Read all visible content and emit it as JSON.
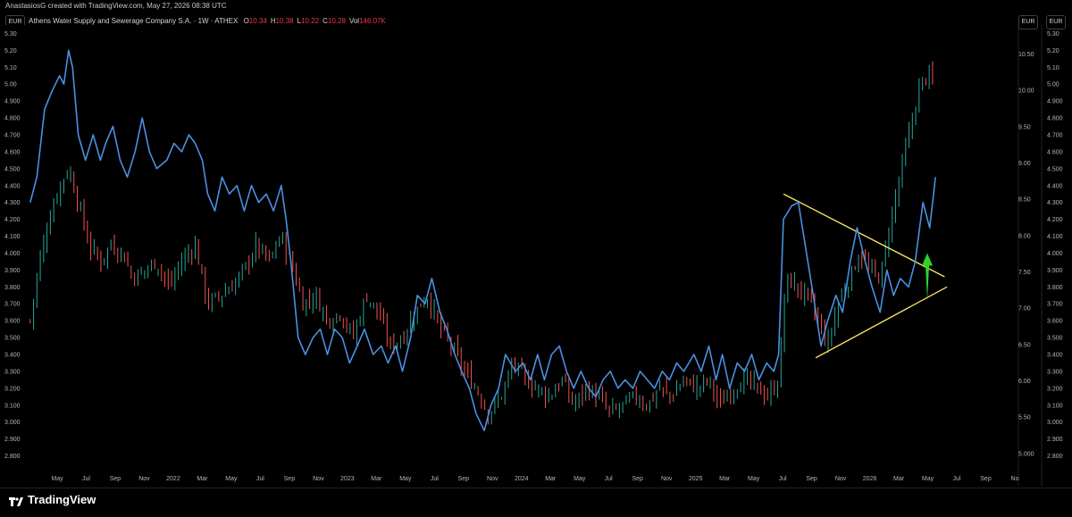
{
  "header": {
    "credit": "AnastasiosG created with TradingView.com, May 27, 2026 08:38 UTC",
    "symbol": "Athens Water Supply and Sewerage Company S.A. · 1W · ATHEX",
    "ohlc": [
      {
        "label": "O",
        "value": "10.34"
      },
      {
        "label": "H",
        "value": "10.38"
      },
      {
        "label": "L",
        "value": "10.22"
      },
      {
        "label": "C",
        "value": "10.28"
      },
      {
        "label": "Vol",
        "value": "146.07K"
      }
    ]
  },
  "currency_left": "EUR",
  "currency_right": "EUR",
  "brand": "TradingView",
  "colors": {
    "up": "#26a69a",
    "down": "#ef5350",
    "overlay_line": "#4a90e2",
    "trendline": "#f5e15a",
    "arrow": "#2bd42b"
  },
  "chart_data": {
    "type": "line",
    "x_ticks": [
      "May",
      "Jul",
      "Sep",
      "Nov",
      "2022",
      "Mar",
      "May",
      "Jul",
      "Sep",
      "Nov",
      "2023",
      "Mar",
      "May",
      "Jul",
      "Sep",
      "Nov",
      "2024",
      "Mar",
      "May",
      "Jul",
      "Sep",
      "Nov",
      "2025",
      "Mar",
      "May",
      "Jul",
      "Sep",
      "Nov",
      "2026",
      "Mar",
      "May",
      "Jul",
      "Sep",
      "No"
    ],
    "y_left_ticks": [
      "5.30",
      "5.20",
      "5.10",
      "5.00",
      "4.900",
      "4.800",
      "4.700",
      "4.600",
      "4.500",
      "4.400",
      "4.300",
      "4.200",
      "4.100",
      "4.000",
      "3.900",
      "3.800",
      "3.700",
      "3.600",
      "3.500",
      "3.400",
      "3.300",
      "3.200",
      "3.100",
      "3.000",
      "2.900",
      "2.800"
    ],
    "y_right_ticks": [
      "5.30",
      "5.20",
      "5.10",
      "5.00",
      "4.900",
      "4.800",
      "4.700",
      "4.600",
      "4.500",
      "4.400",
      "4.300",
      "4.200",
      "4.100",
      "4.000",
      "3.900",
      "3.800",
      "3.700",
      "3.600",
      "3.500",
      "3.400",
      "3.300",
      "3.200",
      "3.100",
      "3.000",
      "2.900",
      "2.800"
    ],
    "y_mid_ticks": [
      "10.50",
      "10.00",
      "9.50",
      "9.00",
      "8.50",
      "8.00",
      "7.50",
      "7.00",
      "6.50",
      "6.00",
      "5.50",
      "5.000"
    ],
    "ylim_left": [
      2.75,
      5.35
    ],
    "ylim_mid": [
      4.85,
      10.9
    ],
    "overlay_series": [
      [
        "2021-04-01",
        4.3
      ],
      [
        "2021-04-15",
        4.45
      ],
      [
        "2021-05-01",
        4.85
      ],
      [
        "2021-05-15",
        4.95
      ],
      [
        "2021-06-01",
        5.05
      ],
      [
        "2021-06-10",
        5.0
      ],
      [
        "2021-06-20",
        5.2
      ],
      [
        "2021-06-28",
        5.1
      ],
      [
        "2021-07-10",
        4.7
      ],
      [
        "2021-07-25",
        4.55
      ],
      [
        "2021-08-10",
        4.7
      ],
      [
        "2021-08-25",
        4.55
      ],
      [
        "2021-09-05",
        4.65
      ],
      [
        "2021-09-20",
        4.75
      ],
      [
        "2021-10-05",
        4.55
      ],
      [
        "2021-10-20",
        4.45
      ],
      [
        "2021-11-05",
        4.6
      ],
      [
        "2021-11-20",
        4.8
      ],
      [
        "2021-12-05",
        4.6
      ],
      [
        "2021-12-20",
        4.5
      ],
      [
        "2022-01-10",
        4.55
      ],
      [
        "2022-01-25",
        4.65
      ],
      [
        "2022-02-10",
        4.6
      ],
      [
        "2022-02-25",
        4.7
      ],
      [
        "2022-03-10",
        4.65
      ],
      [
        "2022-03-25",
        4.55
      ],
      [
        "2022-04-05",
        4.35
      ],
      [
        "2022-04-20",
        4.25
      ],
      [
        "2022-05-05",
        4.45
      ],
      [
        "2022-05-20",
        4.35
      ],
      [
        "2022-06-05",
        4.4
      ],
      [
        "2022-06-20",
        4.25
      ],
      [
        "2022-07-05",
        4.4
      ],
      [
        "2022-07-20",
        4.3
      ],
      [
        "2022-08-05",
        4.35
      ],
      [
        "2022-08-20",
        4.25
      ],
      [
        "2022-09-05",
        4.4
      ],
      [
        "2022-09-15",
        4.2
      ],
      [
        "2022-09-25",
        3.95
      ],
      [
        "2022-10-10",
        3.5
      ],
      [
        "2022-10-25",
        3.4
      ],
      [
        "2022-11-10",
        3.5
      ],
      [
        "2022-11-25",
        3.55
      ],
      [
        "2022-12-10",
        3.4
      ],
      [
        "2022-12-25",
        3.55
      ],
      [
        "2023-01-10",
        3.5
      ],
      [
        "2023-01-25",
        3.35
      ],
      [
        "2023-02-10",
        3.45
      ],
      [
        "2023-02-25",
        3.55
      ],
      [
        "2023-03-15",
        3.4
      ],
      [
        "2023-04-01",
        3.45
      ],
      [
        "2023-04-15",
        3.35
      ],
      [
        "2023-05-01",
        3.45
      ],
      [
        "2023-05-15",
        3.3
      ],
      [
        "2023-06-01",
        3.5
      ],
      [
        "2023-06-15",
        3.75
      ],
      [
        "2023-07-01",
        3.7
      ],
      [
        "2023-07-15",
        3.85
      ],
      [
        "2023-08-01",
        3.65
      ],
      [
        "2023-08-15",
        3.55
      ],
      [
        "2023-09-01",
        3.4
      ],
      [
        "2023-09-15",
        3.3
      ],
      [
        "2023-10-01",
        3.2
      ],
      [
        "2023-10-15",
        3.05
      ],
      [
        "2023-11-01",
        2.95
      ],
      [
        "2023-11-15",
        3.1
      ],
      [
        "2023-12-01",
        3.2
      ],
      [
        "2023-12-15",
        3.4
      ],
      [
        "2024-01-05",
        3.3
      ],
      [
        "2024-01-20",
        3.35
      ],
      [
        "2024-02-05",
        3.25
      ],
      [
        "2024-02-20",
        3.4
      ],
      [
        "2024-03-05",
        3.25
      ],
      [
        "2024-03-20",
        3.4
      ],
      [
        "2024-04-05",
        3.45
      ],
      [
        "2024-04-20",
        3.3
      ],
      [
        "2024-05-05",
        3.2
      ],
      [
        "2024-05-20",
        3.3
      ],
      [
        "2024-06-05",
        3.2
      ],
      [
        "2024-06-20",
        3.15
      ],
      [
        "2024-07-05",
        3.25
      ],
      [
        "2024-07-20",
        3.3
      ],
      [
        "2024-08-05",
        3.2
      ],
      [
        "2024-08-20",
        3.25
      ],
      [
        "2024-09-05",
        3.2
      ],
      [
        "2024-09-20",
        3.3
      ],
      [
        "2024-10-05",
        3.25
      ],
      [
        "2024-10-20",
        3.2
      ],
      [
        "2024-11-05",
        3.3
      ],
      [
        "2024-11-20",
        3.25
      ],
      [
        "2024-12-05",
        3.35
      ],
      [
        "2024-12-20",
        3.3
      ],
      [
        "2025-01-10",
        3.4
      ],
      [
        "2025-01-25",
        3.3
      ],
      [
        "2025-02-10",
        3.45
      ],
      [
        "2025-02-25",
        3.25
      ],
      [
        "2025-03-10",
        3.4
      ],
      [
        "2025-03-25",
        3.2
      ],
      [
        "2025-04-10",
        3.35
      ],
      [
        "2025-04-25",
        3.3
      ],
      [
        "2025-05-10",
        3.4
      ],
      [
        "2025-05-25",
        3.25
      ],
      [
        "2025-06-10",
        3.35
      ],
      [
        "2025-06-25",
        3.3
      ],
      [
        "2025-07-05",
        3.4
      ],
      [
        "2025-07-15",
        4.2
      ],
      [
        "2025-08-01",
        4.28
      ],
      [
        "2025-08-15",
        4.3
      ],
      [
        "2025-09-01",
        4.0
      ],
      [
        "2025-09-15",
        3.75
      ],
      [
        "2025-10-01",
        3.45
      ],
      [
        "2025-10-15",
        3.6
      ],
      [
        "2025-11-01",
        3.75
      ],
      [
        "2025-11-15",
        3.65
      ],
      [
        "2025-12-01",
        3.95
      ],
      [
        "2025-12-15",
        4.15
      ],
      [
        "2026-01-01",
        3.95
      ],
      [
        "2026-01-15",
        3.8
      ],
      [
        "2026-02-01",
        3.65
      ],
      [
        "2026-02-15",
        3.9
      ],
      [
        "2026-03-01",
        3.75
      ],
      [
        "2026-03-15",
        3.85
      ],
      [
        "2026-04-01",
        3.8
      ],
      [
        "2026-04-15",
        3.95
      ],
      [
        "2026-05-01",
        4.3
      ],
      [
        "2026-05-15",
        4.15
      ],
      [
        "2026-05-27",
        4.45
      ]
    ],
    "price_series": [
      [
        "2021-04-01",
        3.6
      ],
      [
        "2021-04-20",
        3.95
      ],
      [
        "2021-05-10",
        4.2
      ],
      [
        "2021-06-01",
        4.4
      ],
      [
        "2021-06-20",
        4.5
      ],
      [
        "2021-07-10",
        4.3
      ],
      [
        "2021-08-01",
        4.05
      ],
      [
        "2021-08-25",
        3.95
      ],
      [
        "2021-09-15",
        4.05
      ],
      [
        "2021-10-10",
        4.0
      ],
      [
        "2021-11-01",
        3.85
      ],
      [
        "2021-11-25",
        3.9
      ],
      [
        "2021-12-20",
        3.95
      ],
      [
        "2022-01-15",
        3.8
      ],
      [
        "2022-02-10",
        3.95
      ],
      [
        "2022-03-10",
        4.05
      ],
      [
        "2022-04-05",
        3.7
      ],
      [
        "2022-05-01",
        3.75
      ],
      [
        "2022-05-25",
        3.8
      ],
      [
        "2022-06-20",
        3.9
      ],
      [
        "2022-07-15",
        4.05
      ],
      [
        "2022-08-10",
        3.95
      ],
      [
        "2022-09-05",
        4.1
      ],
      [
        "2022-09-25",
        3.95
      ],
      [
        "2022-10-20",
        3.7
      ],
      [
        "2022-11-15",
        3.75
      ],
      [
        "2022-12-10",
        3.6
      ],
      [
        "2023-01-05",
        3.65
      ],
      [
        "2023-02-01",
        3.5
      ],
      [
        "2023-03-01",
        3.75
      ],
      [
        "2023-03-25",
        3.65
      ],
      [
        "2023-04-20",
        3.45
      ],
      [
        "2023-05-15",
        3.5
      ],
      [
        "2023-06-10",
        3.65
      ],
      [
        "2023-07-05",
        3.75
      ],
      [
        "2023-08-01",
        3.55
      ],
      [
        "2023-08-25",
        3.45
      ],
      [
        "2023-09-20",
        3.3
      ],
      [
        "2023-10-15",
        3.2
      ],
      [
        "2023-11-10",
        3.05
      ],
      [
        "2023-12-05",
        3.15
      ],
      [
        "2024-01-01",
        3.35
      ],
      [
        "2024-01-25",
        3.25
      ],
      [
        "2024-02-20",
        3.2
      ],
      [
        "2024-03-15",
        3.15
      ],
      [
        "2024-04-10",
        3.25
      ],
      [
        "2024-05-05",
        3.1
      ],
      [
        "2024-05-30",
        3.2
      ],
      [
        "2024-06-25",
        3.15
      ],
      [
        "2024-07-20",
        3.05
      ],
      [
        "2024-08-15",
        3.1
      ],
      [
        "2024-09-10",
        3.15
      ],
      [
        "2024-10-05",
        3.1
      ],
      [
        "2024-10-30",
        3.2
      ],
      [
        "2024-11-25",
        3.15
      ],
      [
        "2024-12-20",
        3.25
      ],
      [
        "2025-01-15",
        3.2
      ],
      [
        "2025-02-10",
        3.25
      ],
      [
        "2025-03-05",
        3.1
      ],
      [
        "2025-04-01",
        3.2
      ],
      [
        "2025-04-25",
        3.25
      ],
      [
        "2025-05-20",
        3.2
      ],
      [
        "2025-06-15",
        3.15
      ],
      [
        "2025-07-05",
        3.25
      ],
      [
        "2025-07-20",
        3.85
      ],
      [
        "2025-08-10",
        3.8
      ],
      [
        "2025-09-01",
        3.75
      ],
      [
        "2025-09-25",
        3.6
      ],
      [
        "2025-10-15",
        3.45
      ],
      [
        "2025-11-05",
        3.7
      ],
      [
        "2025-11-30",
        3.85
      ],
      [
        "2025-12-20",
        4.0
      ],
      [
        "2026-01-10",
        3.9
      ],
      [
        "2026-02-01",
        3.85
      ],
      [
        "2026-02-20",
        4.15
      ],
      [
        "2026-03-10",
        4.4
      ],
      [
        "2026-03-25",
        4.6
      ],
      [
        "2026-04-10",
        4.8
      ],
      [
        "2026-04-25",
        5.0
      ],
      [
        "2026-05-10",
        5.05
      ],
      [
        "2026-05-27",
        5.0
      ]
    ],
    "trendlines": [
      {
        "from": [
          "2025-07-15",
          4.35
        ],
        "to": [
          "2026-06-15",
          3.86
        ]
      },
      {
        "from": [
          "2025-09-20",
          3.38
        ],
        "to": [
          "2026-06-20",
          3.8
        ]
      }
    ],
    "arrow": {
      "x": "2026-05-10",
      "from": 3.72,
      "to": 4.0
    },
    "grid": false
  }
}
